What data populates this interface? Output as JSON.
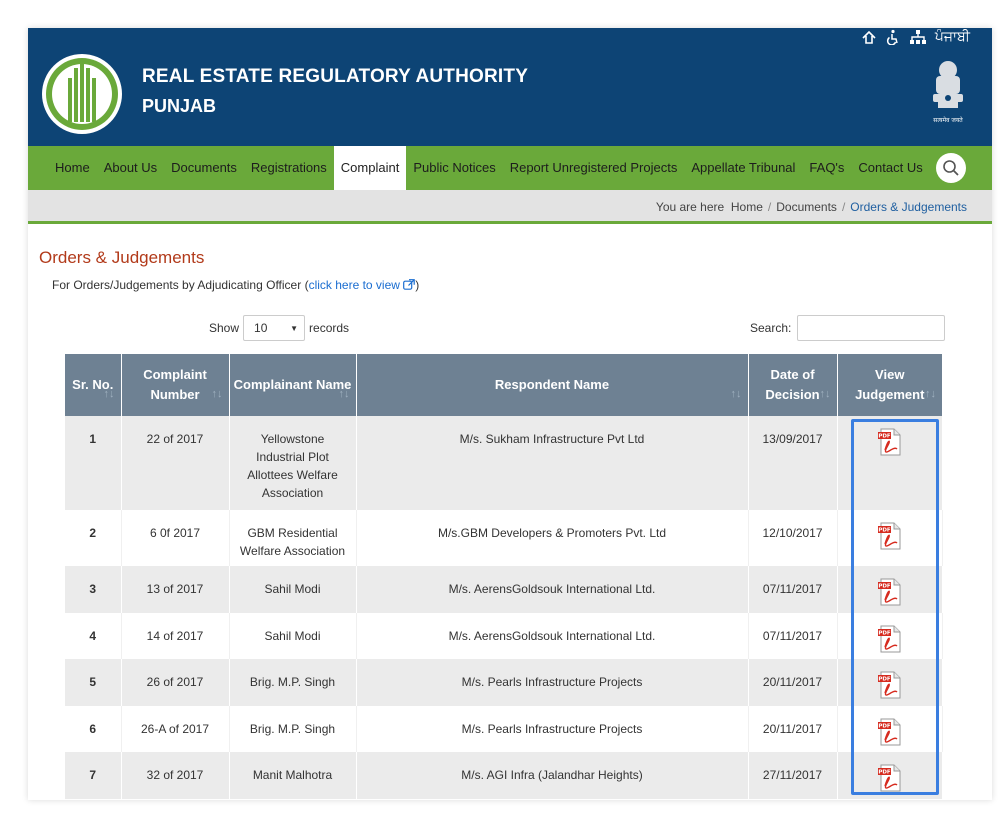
{
  "header": {
    "title_line1": "REAL ESTATE REGULATORY AUTHORITY",
    "title_line2": "PUNJAB",
    "language_label": "ਪੰਜਾਬੀ",
    "emblem_caption": "सत्यमेव जयते"
  },
  "nav": {
    "items": [
      "Home",
      "About Us",
      "Documents",
      "Registrations",
      "Complaint",
      "Public Notices",
      "Report Unregistered Projects",
      "Appellate Tribunal",
      "FAQ's",
      "Contact Us"
    ],
    "active": "Complaint"
  },
  "breadcrumb": {
    "prefix": "You are here",
    "items": [
      "Home",
      "Documents",
      "Orders & Judgements"
    ]
  },
  "page": {
    "title": "Orders & Judgements",
    "info_text": "For Orders/Judgements by Adjudicating Officer (",
    "info_link": "click here to view",
    "info_close": ")"
  },
  "controls": {
    "show_label": "Show",
    "records_value": "10",
    "records_label": "records",
    "search_label": "Search:"
  },
  "table": {
    "columns": [
      "Sr. No.",
      "Complaint Number",
      "Complainant Name",
      "Respondent Name",
      "Date of Decision",
      "View Judgement"
    ],
    "rows": [
      {
        "sr": "1",
        "complaint": "22 of 2017",
        "complainant": "Yellowstone Industrial Plot Allottees Welfare Association",
        "respondent": "M/s. Sukham Infrastructure Pvt Ltd",
        "date": "13/09/2017"
      },
      {
        "sr": "2",
        "complaint": "6 0f 2017",
        "complainant": "GBM Residential Welfare Association",
        "respondent": "M/s.GBM Developers & Promoters Pvt. Ltd",
        "date": "12/10/2017"
      },
      {
        "sr": "3",
        "complaint": "13 of 2017",
        "complainant": "Sahil Modi",
        "respondent": "M/s. AerensGoldsouk International Ltd.",
        "date": "07/11/2017"
      },
      {
        "sr": "4",
        "complaint": "14 of 2017",
        "complainant": "Sahil Modi",
        "respondent": "M/s. AerensGoldsouk International Ltd.",
        "date": "07/11/2017"
      },
      {
        "sr": "5",
        "complaint": "26 of 2017",
        "complainant": "Brig. M.P. Singh",
        "respondent": "M/s. Pearls Infrastructure Projects",
        "date": "20/11/2017"
      },
      {
        "sr": "6",
        "complaint": "26-A of 2017",
        "complainant": "Brig. M.P. Singh",
        "respondent": "M/s. Pearls Infrastructure Projects",
        "date": "20/11/2017"
      },
      {
        "sr": "7",
        "complaint": "32 of 2017",
        "complainant": "Manit Malhotra",
        "respondent": "M/s. AGI Infra (Jalandhar Heights)",
        "date": "27/11/2017"
      }
    ]
  },
  "colors": {
    "header_bg": "#0d4475",
    "nav_bg": "#6aa93a",
    "table_header_bg": "#6e8193",
    "title_color": "#b23a1a",
    "highlight": "#3a7ee0"
  }
}
